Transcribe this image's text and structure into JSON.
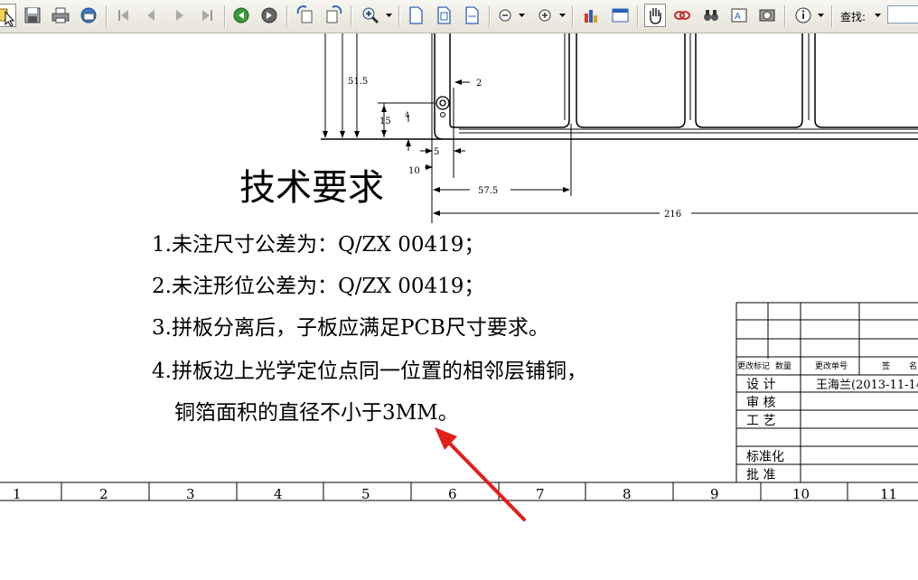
{
  "toolbar": {
    "find_label": "查找:",
    "find_value": "",
    "icons": [
      "select-tool-icon",
      "save-icon",
      "print-icon",
      "email-icon",
      "first-page-icon",
      "previous-page-icon",
      "next-page-icon",
      "last-page-icon",
      "go-back-icon",
      "go-forward-icon",
      "rotate-ccw-icon",
      "rotate-cw-icon",
      "zoom-icon",
      "actual-size-icon",
      "fit-page-icon",
      "fit-width-icon",
      "zoom-out-icon",
      "zoom-in-icon",
      "chart-icon",
      "window-icon",
      "hand-tool-icon",
      "link-icon",
      "find-icon",
      "text-select-icon",
      "snapshot-icon",
      "info-icon"
    ]
  },
  "drawing": {
    "title": "技术要求",
    "requirements": [
      "1.未注尺寸公差为：Q/ZX 00419；",
      "2.未注形位公差为：Q/ZX 00419；",
      "3.拼板分离后，子板应满足PCB尺寸要求。",
      "4.拼板边上光学定位点同一位置的相邻层铺铜，",
      "铜箔面积的直径不小于3MM。"
    ],
    "dimensions": [
      "51.5",
      "2",
      "15",
      "4",
      "5",
      "10",
      "57.5",
      "216"
    ],
    "title_block": {
      "header": [
        "更改标记",
        "数量",
        "更改单号",
        "签",
        "名"
      ],
      "rows": [
        "设  计",
        "审  核",
        "工  艺",
        "",
        "标准化",
        "批  准"
      ],
      "designer": "王海兰(2013-11-14"
    },
    "ruler": [
      "1",
      "2",
      "3",
      "4",
      "5",
      "6",
      "7",
      "8",
      "9",
      "10",
      "11"
    ]
  },
  "colors": {
    "annotation_arrow": "#e0201c"
  }
}
